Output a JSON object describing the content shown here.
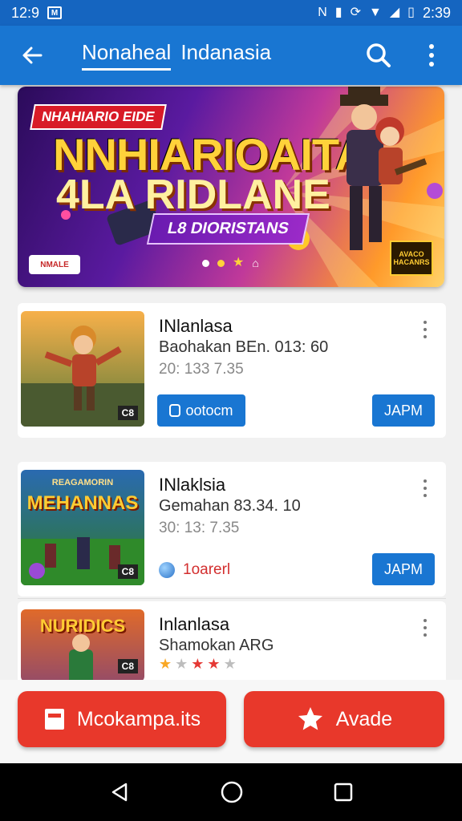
{
  "status_bar": {
    "time_left": "12:9",
    "time_right": "2:39",
    "notif_icon": "notification-box-icon"
  },
  "app_bar": {
    "title_tab": "Nonaheal",
    "title_rest": "Indanasia"
  },
  "banner": {
    "tag": "NHAHIARIO EIDE",
    "headline_1": "NNHIARIOAITA",
    "headline_2": "4LA RIDLANE",
    "subtitle": "L8 DIORISTANS",
    "badge": "AVACO HACANRS",
    "card": "NMALE"
  },
  "games": [
    {
      "title": "INlanlasa",
      "subtitle": "Baohakan BEn. 013: 60",
      "meta": "20: 133 7.35",
      "thumb_tag": "C8",
      "action_label": "ootocm",
      "get_label": "JAPM"
    },
    {
      "title": "INlaklsia",
      "subtitle": "Gemahan 83.34. 10",
      "meta": "30: 13: 7.35",
      "thumb_title": "MEHANNAS",
      "thumb_top": "REAGAMORIN",
      "thumb_tag": "C8",
      "link_label": "1oarerl",
      "get_label": "JAPM"
    },
    {
      "title": "Inlanlasa",
      "subtitle": "Shamokan ARG",
      "thumb_title": "NURIDICS",
      "thumb_tag": "C8",
      "rating": 3.5
    }
  ],
  "bottom_actions": {
    "left_label": "Mcokampa.its",
    "right_label": "Avade"
  },
  "colors": {
    "primary": "#1976d2",
    "accent_red": "#e8382b",
    "status_bar": "#1565c0"
  }
}
